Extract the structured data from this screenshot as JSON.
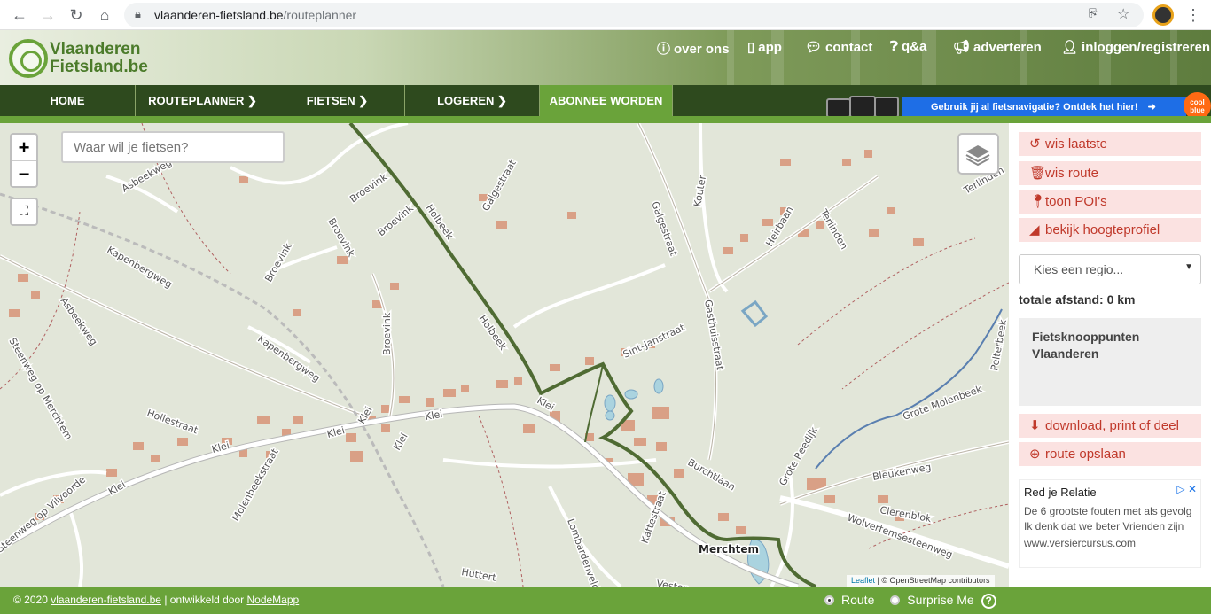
{
  "browser": {
    "url_host": "vlaanderen-fietsland.be",
    "url_path": "/routeplanner"
  },
  "header": {
    "logo_line1": "Vlaanderen",
    "logo_line2": "Fietsland.be",
    "links": [
      {
        "icon": "info-icon",
        "label": "over ons"
      },
      {
        "icon": "mobile-icon",
        "label": "app"
      },
      {
        "icon": "chat-icon",
        "label": "contact"
      },
      {
        "icon": "question-icon",
        "label": "q&a"
      },
      {
        "icon": "megaphone-icon",
        "label": "adverteren"
      },
      {
        "icon": "user-icon",
        "label": "inloggen/registreren"
      }
    ]
  },
  "nav": {
    "items": [
      {
        "label": "HOME"
      },
      {
        "label": "ROUTEPLANNER ❯"
      },
      {
        "label": "FIETSEN ❯"
      },
      {
        "label": "LOGEREN ❯"
      },
      {
        "label": "ABONNEE WORDEN"
      }
    ],
    "banner_text": "Gebruik jij al fietsnavigatie? Ontdek het hier!",
    "banner_brand": "cool blue"
  },
  "map": {
    "search_placeholder": "Waar wil je fietsen?",
    "zoom_in": "+",
    "zoom_out": "−",
    "attribution_leaflet": "Leaflet",
    "attribution_rest": " | © OpenStreetMap contributors",
    "town_label": "Merchtem",
    "street_labels": [
      "Asbeekweg",
      "Asbeekweg",
      "Kapenbergweg",
      "Kapenbergweg",
      "Broevink",
      "Broevink",
      "Broevink",
      "Broevink",
      "Broevink",
      "Galgestraat",
      "Galgestraat",
      "Kouter",
      "Heirbaan",
      "Terlinden",
      "Terlinden",
      "Gasthuisstraat",
      "Sint-Janstraat",
      "Holbeek",
      "Holbeek",
      "Steenweg op Merchtem",
      "Hollestraat",
      "Klei",
      "Klei",
      "Klei",
      "Klei",
      "Klei",
      "Klei",
      "Molenbeekstraat",
      "Steenweg op Vilvoorde",
      "Lombardenveld",
      "Kattestraat",
      "Burchtlaan",
      "Grote Molenbeek",
      "Bleukenweg",
      "Clerenblok",
      "Wolvertemsesteenweg",
      "Grote Reedijk",
      "Huttert",
      "Vesten",
      "Pelterbeek"
    ]
  },
  "sidebar": {
    "buttons": [
      {
        "icon": "undo-icon",
        "label": "wis laatste"
      },
      {
        "icon": "trash-icon",
        "label": "wis route"
      },
      {
        "icon": "pin-icon",
        "label": "toon POI's"
      },
      {
        "icon": "chart-icon",
        "label": "bekijk hoogteprofiel"
      }
    ],
    "region_placeholder": "Kies een regio...",
    "distance": "totale afstand: 0 km",
    "network_title": "Fietsknooppunten Vlaanderen",
    "buttons2": [
      {
        "icon": "download-icon",
        "label": "download, print of deel"
      },
      {
        "icon": "plus-circle-icon",
        "label": "route opslaan"
      }
    ],
    "ad": {
      "title": "Red je Relatie",
      "body": "De 6 grootste fouten met als gevolg Ik denk dat we beter Vrienden zijn",
      "url": "www.versiercursus.com"
    }
  },
  "footer": {
    "copyright": "© 2020 ",
    "site_link": "vlaanderen-fietsland.be",
    "developed": " | ontwikkeld door ",
    "dev_link": "NodeMapp",
    "option_route": "Route",
    "option_surprise": "Surprise Me",
    "help": "?"
  },
  "colors": {
    "nav_bg": "#2e4a1e",
    "accent_green": "#6aa33a",
    "button_red": "#c0392b",
    "button_bg": "#fbe2e1",
    "route_green": "#4f6b33"
  }
}
